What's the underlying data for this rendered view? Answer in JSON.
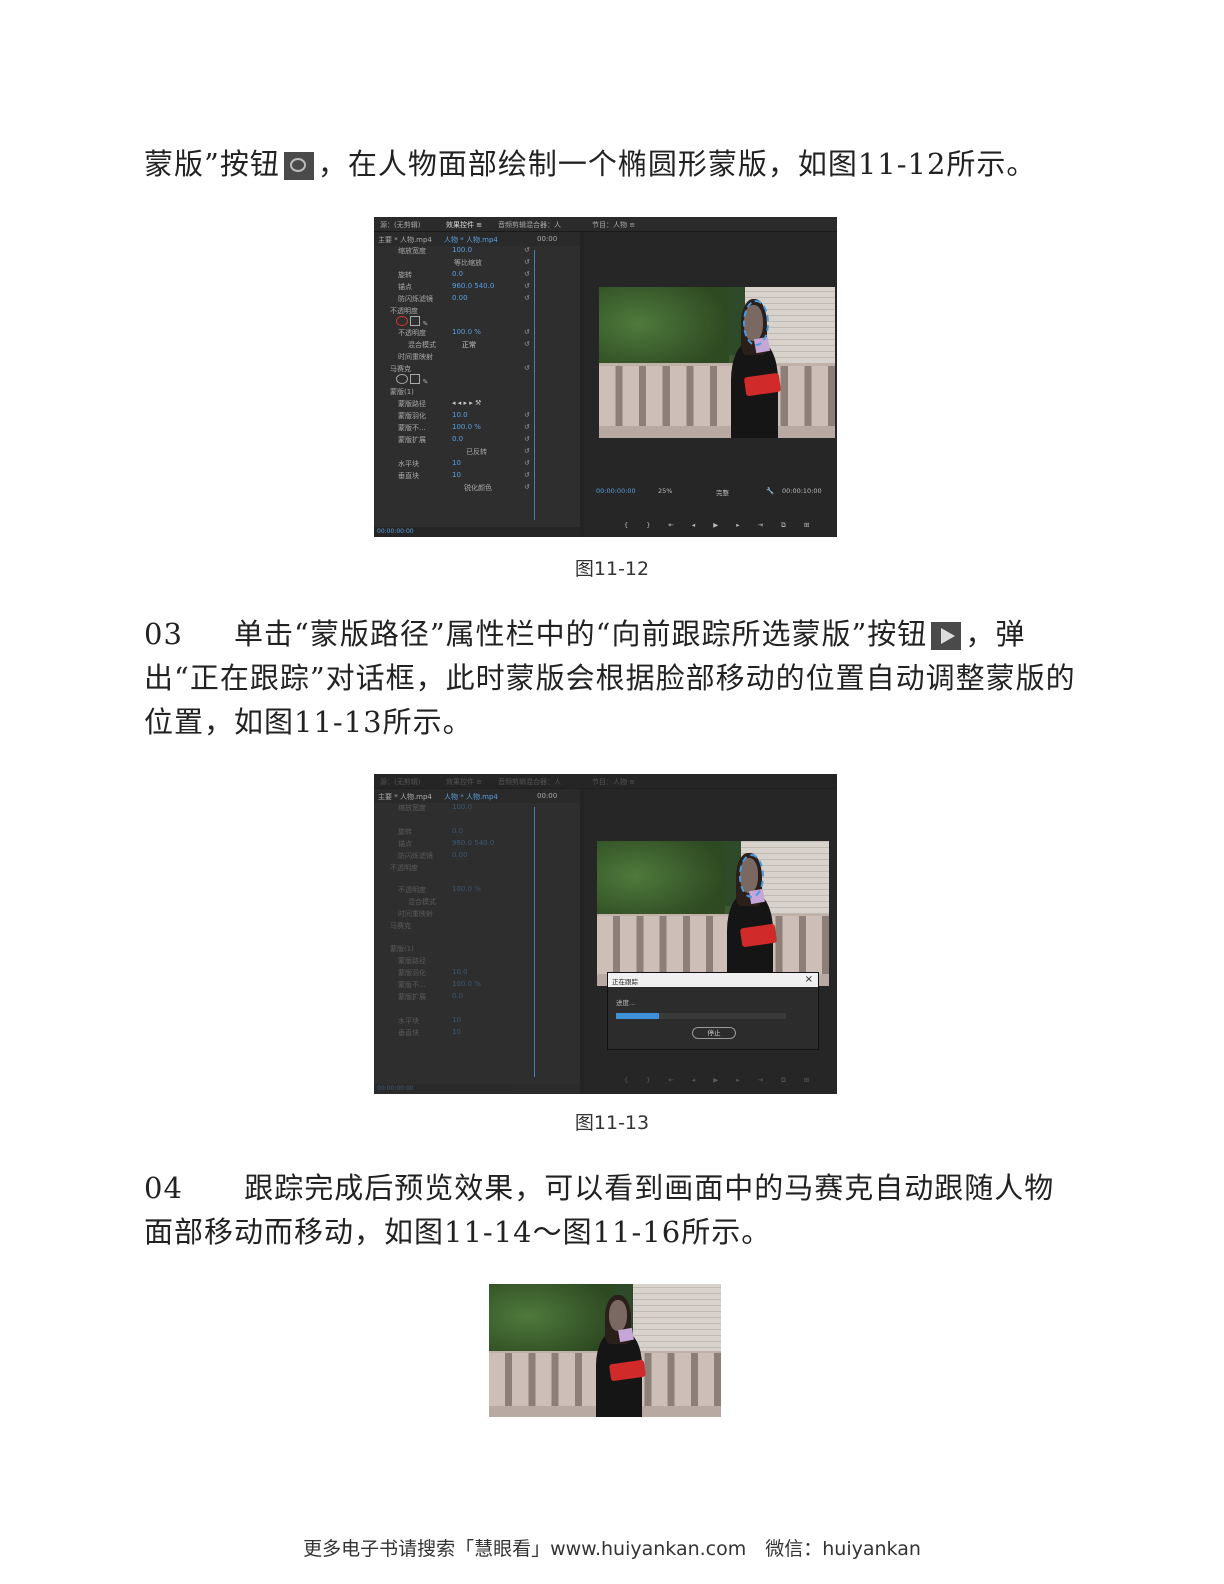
{
  "paragraphs": {
    "p1": {
      "text_before": "蒙版”按钮",
      "text_after": "，在人物面部绘制一个椭圆形蒙版，如图11-12所示。",
      "icon": "ellipse-mask-icon"
    },
    "p3": {
      "number": "03",
      "text_before": "单击“蒙版路径”属性栏中的“向前跟踪所选蒙版”按钮",
      "text_after": "，弹出“正在跟踪”对话框，此时蒙版会根据脸部移动的位置自动调整蒙版的位置，如图11-13所示。",
      "icon": "track-forward-icon"
    },
    "p4": {
      "number": "04",
      "text": "跟踪完成后预览效果，可以看到画面中的马赛克自动跟随人物面部移动而移动，如图11-14～图11-16所示。"
    }
  },
  "captions": {
    "fig12": "图11-12",
    "fig13": "图11-13"
  },
  "screenshot": {
    "tabs": [
      "源：(无剪辑)",
      "效果控件 ≡",
      "音频剪辑混合器：人",
      "节目：人物 ≡"
    ],
    "source_label": "主要 * 人物.mp4",
    "clip_label": "人物 * 人物.mp4",
    "timecode_top": "00:00",
    "properties": [
      {
        "label": "缩放宽度",
        "value": "100.0"
      },
      {
        "label": "等比缩放",
        "value": ""
      },
      {
        "label": "旋转",
        "value": "0.0"
      },
      {
        "label": "锚点",
        "value": "960.0    540.0"
      },
      {
        "label": "防闪烁滤镜",
        "value": "0.00"
      },
      {
        "label": "不透明度",
        "value": ""
      },
      {
        "label": "不透明度",
        "value": "100.0 %"
      },
      {
        "label": "混合模式",
        "value": "正常"
      },
      {
        "label": "时间重映射",
        "value": ""
      },
      {
        "label": "马赛克",
        "value": ""
      },
      {
        "label": "蒙版(1)",
        "value": ""
      },
      {
        "label": "蒙版路径",
        "value": ""
      },
      {
        "label": "蒙版羽化",
        "value": "10.0"
      },
      {
        "label": "蒙版不...",
        "value": "100.0 %"
      },
      {
        "label": "蒙版扩展",
        "value": "0.0"
      },
      {
        "label": "已反转",
        "value": ""
      },
      {
        "label": "水平块",
        "value": "10"
      },
      {
        "label": "垂直块",
        "value": "10"
      },
      {
        "label": "锐化颜色",
        "value": ""
      }
    ],
    "timecode_bottom_left": "00:00:00:00",
    "program_timecode": "00:00:00:00",
    "zoom": "25%",
    "quality": "完整",
    "duration": "00:00:10:00",
    "dialog": {
      "title": "正在跟踪",
      "status": "进度...",
      "progress": 0.25,
      "stop_label": "停止"
    }
  },
  "footer": "更多电子书请搜索「慧眼看」www.huiyankan.com　微信：huiyankan",
  "colors": {
    "panel_bg": "#2e2e2e",
    "accent_blue": "#3f8fd6",
    "text": "#222222"
  }
}
